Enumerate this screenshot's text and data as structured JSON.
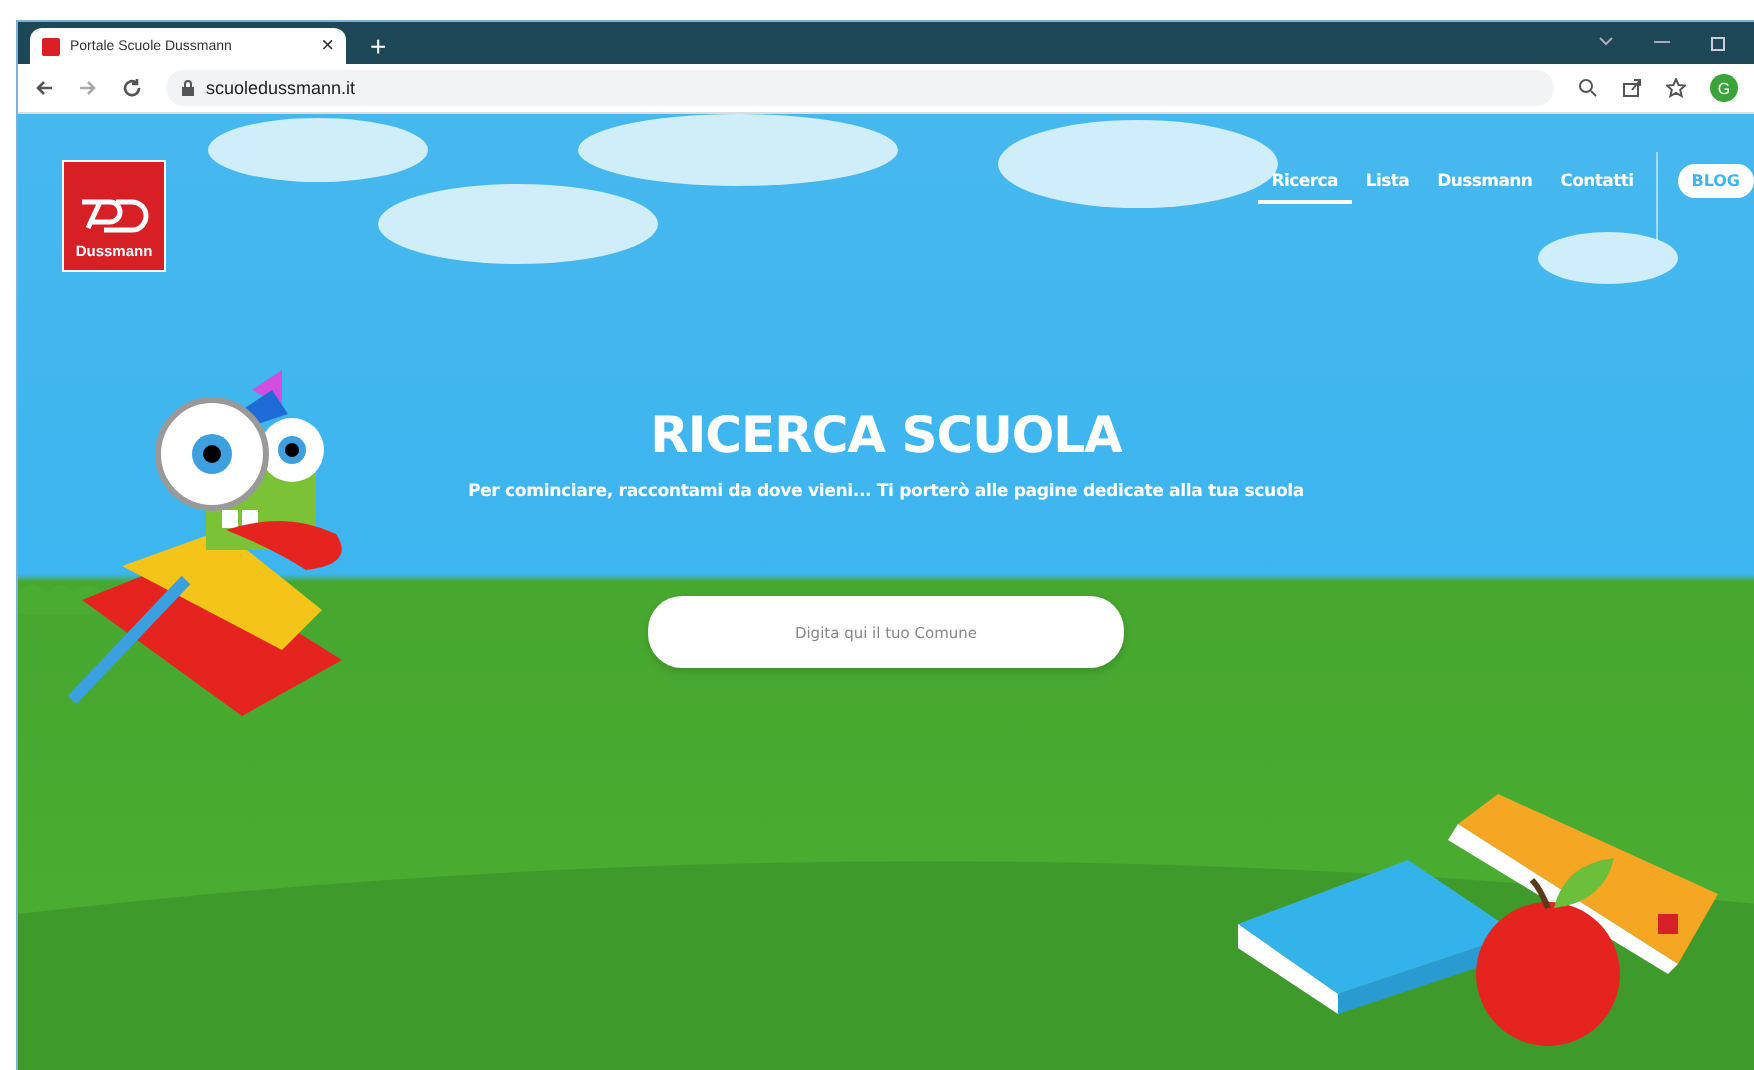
{
  "browser": {
    "tab_title": "Portale Scuole Dussmann",
    "close_tab": "×",
    "new_tab": "+",
    "url": "scuoledussmann.it",
    "profile_initial": "G"
  },
  "header": {
    "logo_text": "Dussmann",
    "nav": [
      {
        "label": "Ricerca",
        "selected": true
      },
      {
        "label": "Lista",
        "selected": false
      },
      {
        "label": "Dussmann",
        "selected": false
      },
      {
        "label": "Contatti",
        "selected": false
      }
    ],
    "blog_button": "BLOG"
  },
  "hero": {
    "title": "RICERCA SCUOLA",
    "subtitle": "Per cominciare, raccontami da dove vieni... Ti porterò alle pagine dedicate alla tua scuola",
    "search": {
      "placeholder": "Digita qui il tuo Comune"
    }
  }
}
